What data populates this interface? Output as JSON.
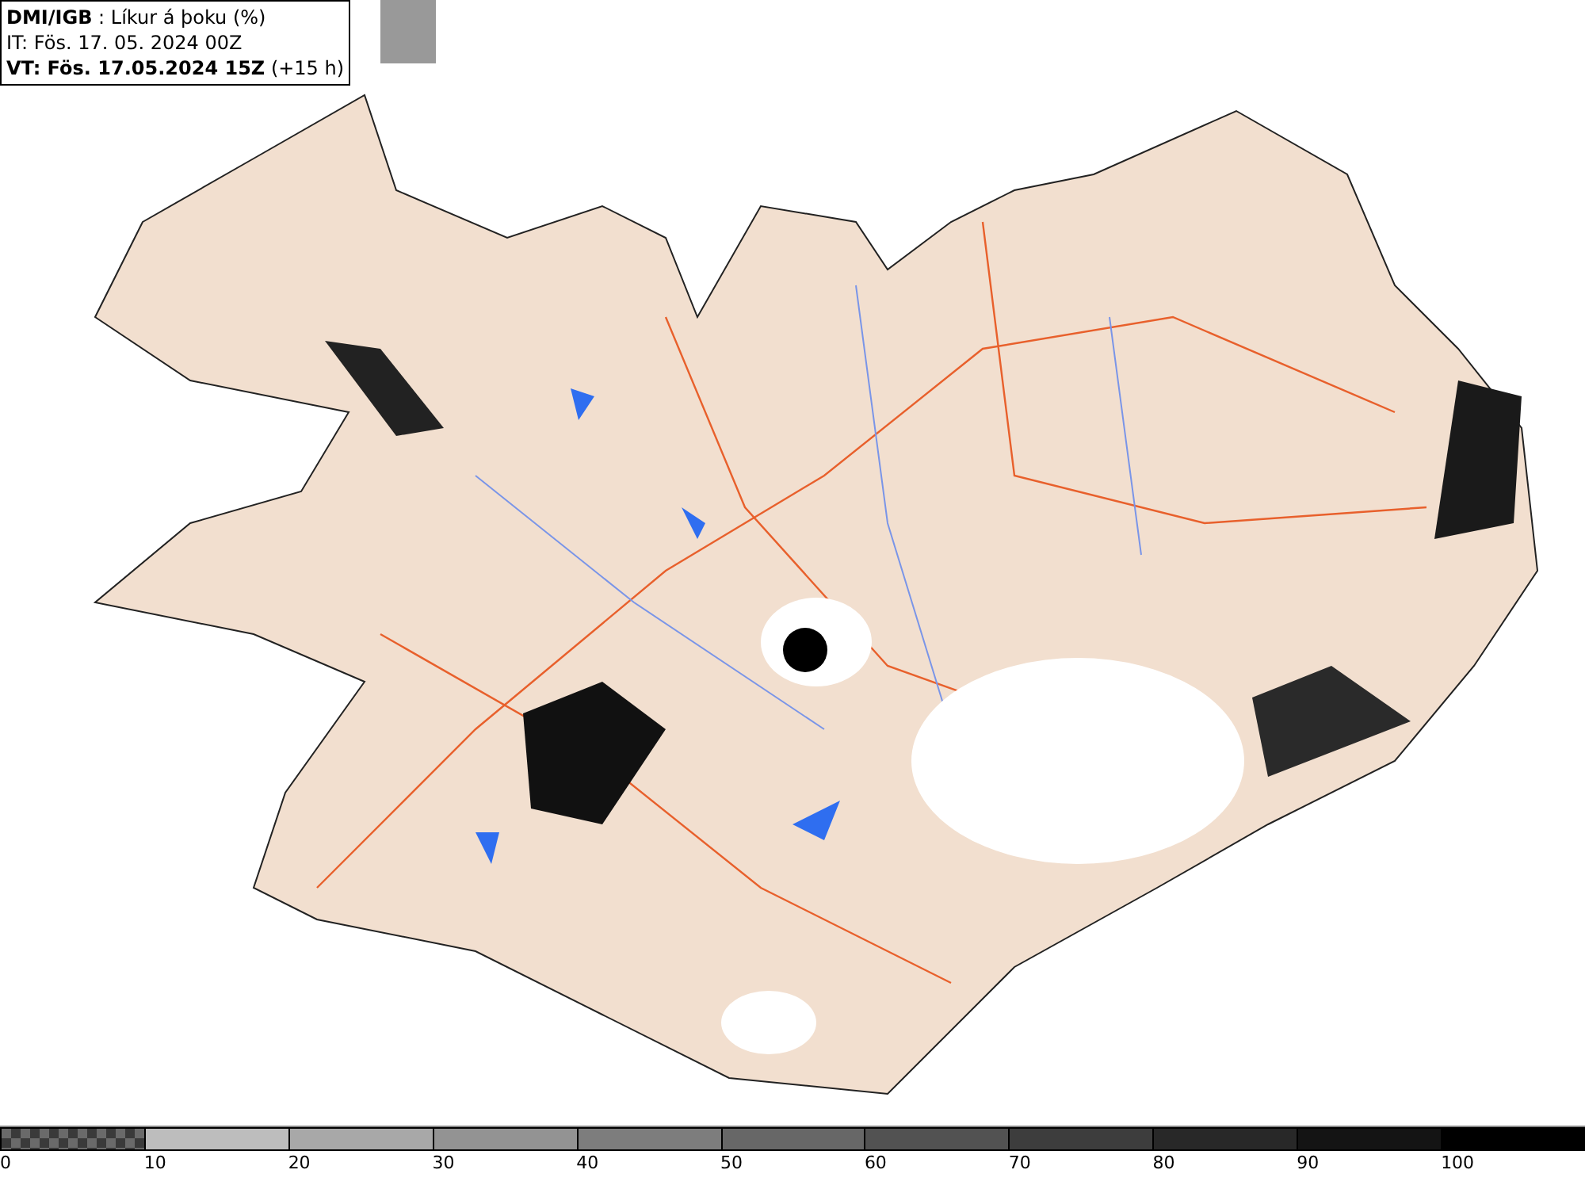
{
  "header": {
    "lines": [
      "**DMI/IGB** : Líkur á þoku (%)",
      "IT: Fös. 17. 05. 2024 00Z",
      "**VT: Fös. 17.05.2024 15Z** (+15 h)"
    ]
  },
  "legend": [
    {
      "label": "0",
      "kind": "checker",
      "color": "#6a6a6a"
    },
    {
      "label": "10",
      "kind": "solid",
      "color": "#bdbdbd"
    },
    {
      "label": "20",
      "kind": "solid",
      "color": "#a8a8a8"
    },
    {
      "label": "30",
      "kind": "solid",
      "color": "#939393"
    },
    {
      "label": "40",
      "kind": "solid",
      "color": "#7d7d7d"
    },
    {
      "label": "50",
      "kind": "solid",
      "color": "#676767"
    },
    {
      "label": "60",
      "kind": "solid",
      "color": "#525252"
    },
    {
      "label": "70",
      "kind": "solid",
      "color": "#3d3d3d"
    },
    {
      "label": "80",
      "kind": "solid",
      "color": "#282828"
    },
    {
      "label": "90",
      "kind": "solid",
      "color": "#141414"
    },
    {
      "label": "100",
      "kind": "solid",
      "color": "#000000"
    }
  ]
}
